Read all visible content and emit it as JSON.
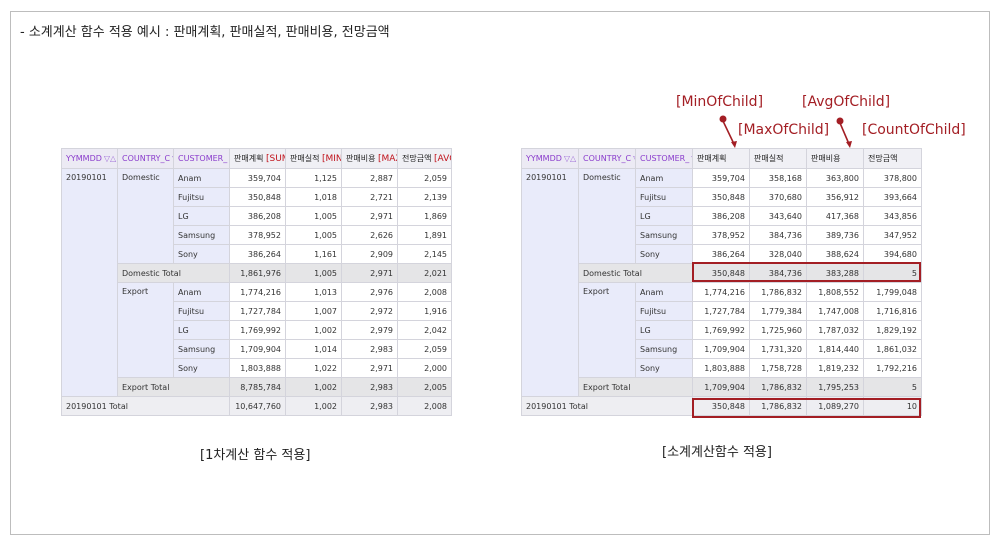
{
  "heading": "- 소계계산 함수 적용 예시 : 판매계획, 판매실적, 판매비용, 전망금액",
  "table1": {
    "headers": {
      "yymmdd": "YYMMDD",
      "country": "COUNTRY_C",
      "customer": "CUSTOMER_",
      "c1": "판매계획",
      "c1_agg": "[SUM]",
      "c2": "판매실적",
      "c2_agg": "[MIN]",
      "c3": "판매비용",
      "c3_agg": "[MAX]",
      "c4": "전망금액",
      "c4_agg": "[AVG]"
    },
    "date": "20190101",
    "domestic": "Domestic",
    "export": "Export",
    "rows": [
      [
        "Anam",
        "359,704",
        "1,125",
        "2,887",
        "2,059"
      ],
      [
        "Fujitsu",
        "350,848",
        "1,018",
        "2,721",
        "2,139"
      ],
      [
        "LG",
        "386,208",
        "1,005",
        "2,971",
        "1,869"
      ],
      [
        "Samsung",
        "378,952",
        "1,005",
        "2,626",
        "1,891"
      ],
      [
        "Sony",
        "386,264",
        "1,161",
        "2,909",
        "2,145"
      ]
    ],
    "domestic_total": [
      "Domestic Total",
      "1,861,976",
      "1,005",
      "2,971",
      "2,021"
    ],
    "export_rows": [
      [
        "Anam",
        "1,774,216",
        "1,013",
        "2,976",
        "2,008"
      ],
      [
        "Fujitsu",
        "1,727,784",
        "1,007",
        "2,972",
        "1,916"
      ],
      [
        "LG",
        "1,769,992",
        "1,002",
        "2,979",
        "2,042"
      ],
      [
        "Samsung",
        "1,709,904",
        "1,014",
        "2,983",
        "2,059"
      ],
      [
        "Sony",
        "1,803,888",
        "1,022",
        "2,971",
        "2,000"
      ]
    ],
    "export_total": [
      "Export Total",
      "8,785,784",
      "1,002",
      "2,983",
      "2,005"
    ],
    "grand_total": [
      "20190101 Total",
      "10,647,760",
      "1,002",
      "2,983",
      "2,008"
    ]
  },
  "table2": {
    "headers": {
      "yymmdd": "YYMMDD",
      "country": "COUNTRY_C",
      "customer": "CUSTOMER_",
      "c1": "판매계획",
      "c2": "판매실적",
      "c3": "판매비용",
      "c4": "전망금액"
    },
    "date": "20190101",
    "domestic": "Domestic",
    "export": "Export",
    "rows": [
      [
        "Anam",
        "359,704",
        "358,168",
        "363,800",
        "378,800"
      ],
      [
        "Fujitsu",
        "350,848",
        "370,680",
        "356,912",
        "393,664"
      ],
      [
        "LG",
        "386,208",
        "343,640",
        "417,368",
        "343,856"
      ],
      [
        "Samsung",
        "378,952",
        "384,736",
        "389,736",
        "347,952"
      ],
      [
        "Sony",
        "386,264",
        "328,040",
        "388,624",
        "394,680"
      ]
    ],
    "domestic_total": [
      "Domestic Total",
      "350,848",
      "384,736",
      "383,288",
      "5"
    ],
    "export_rows": [
      [
        "Anam",
        "1,774,216",
        "1,786,832",
        "1,808,552",
        "1,799,048"
      ],
      [
        "Fujitsu",
        "1,727,784",
        "1,779,384",
        "1,747,008",
        "1,716,816"
      ],
      [
        "LG",
        "1,769,992",
        "1,725,960",
        "1,787,032",
        "1,829,192"
      ],
      [
        "Samsung",
        "1,709,904",
        "1,731,320",
        "1,814,440",
        "1,861,032"
      ],
      [
        "Sony",
        "1,803,888",
        "1,758,728",
        "1,819,232",
        "1,792,216"
      ]
    ],
    "export_total": [
      "Export Total",
      "1,709,904",
      "1,786,832",
      "1,795,253",
      "5"
    ],
    "grand_total": [
      "20190101 Total",
      "350,848",
      "1,786,832",
      "1,089,270",
      "10"
    ]
  },
  "callouts": {
    "min": "[MinOfChild]",
    "avg": "[AvgOfChild]",
    "max": "[MaxOfChild]",
    "count": "[CountOfChild]"
  },
  "captions": {
    "left": "[1차계산 함수 적용]",
    "right": "[소계계산함수 적용]"
  },
  "colors": {
    "accent_red": "#a31e24",
    "header_purple": "#8a3ccc",
    "dim_cell": "#e9ebfa"
  },
  "icons": [
    "filter-sort-icon",
    "pin-marker-icon"
  ]
}
